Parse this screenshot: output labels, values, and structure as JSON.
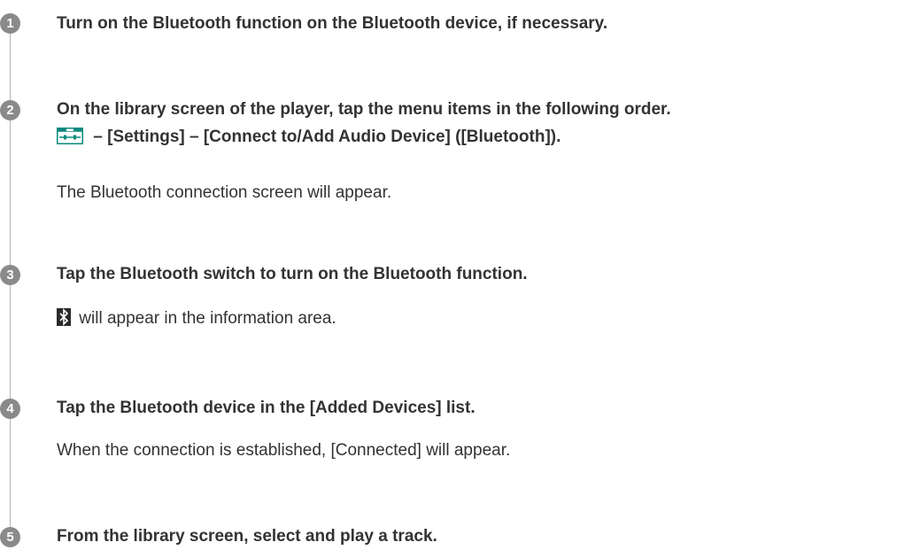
{
  "steps": [
    {
      "number": "1",
      "title": "Turn on the Bluetooth function on the Bluetooth device, if necessary."
    },
    {
      "number": "2",
      "title_line1": "On the library screen of the player, tap the menu items in the following order.",
      "title_line2": " – [Settings] – [Connect to/Add Audio Device] ([Bluetooth]).",
      "icon": "menu-icon",
      "description": "The Bluetooth connection screen will appear."
    },
    {
      "number": "3",
      "title": "Tap the Bluetooth switch to turn on the Bluetooth function.",
      "icon": "bluetooth-icon",
      "description": " will appear in the information area."
    },
    {
      "number": "4",
      "title": "Tap the Bluetooth device in the [Added Devices] list.",
      "description": "When the connection is established, [Connected] will appear."
    },
    {
      "number": "5",
      "title": "From the library screen, select and play a track."
    }
  ],
  "colors": {
    "text": "#333333",
    "step_badge": "#8a8a8a",
    "timeline": "#b5b5b5",
    "menu_icon_teal": "#0a8a7e"
  }
}
